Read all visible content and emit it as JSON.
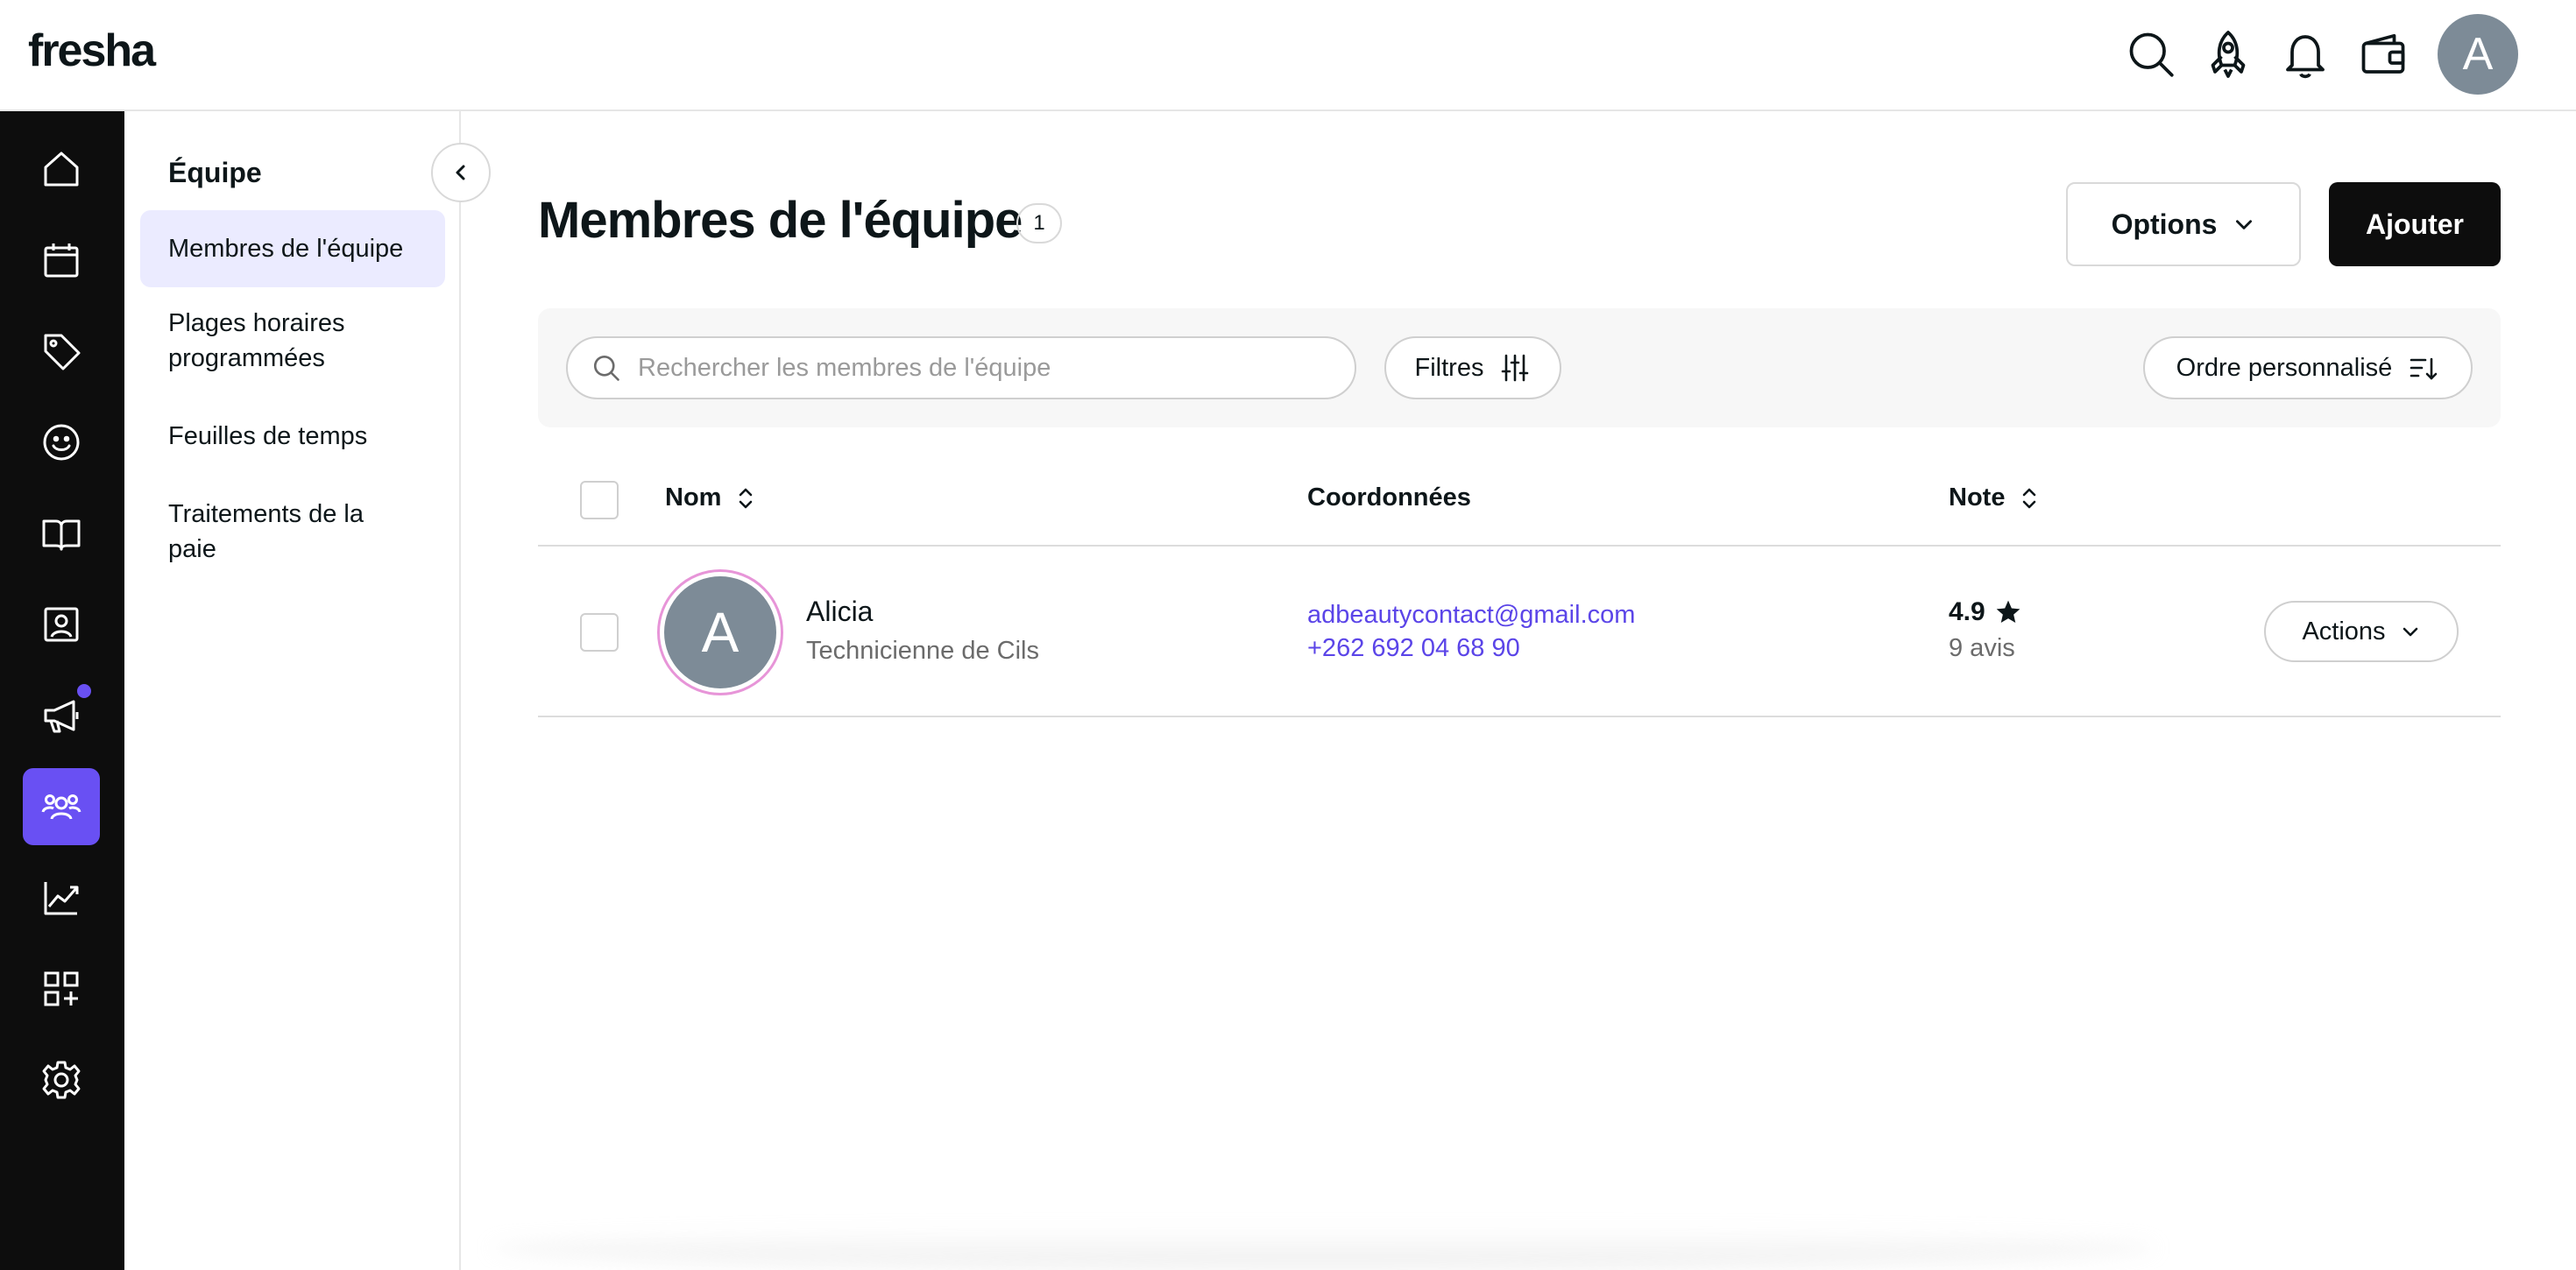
{
  "app": {
    "logo": "fresha",
    "avatar_initial": "A"
  },
  "topbar_icons": [
    "search-icon",
    "rocket-icon",
    "bell-icon",
    "wallet-icon"
  ],
  "rail": {
    "items": [
      {
        "name": "home",
        "icon": "home-icon"
      },
      {
        "name": "calendar",
        "icon": "calendar-icon"
      },
      {
        "name": "sales",
        "icon": "tag-icon"
      },
      {
        "name": "clients",
        "icon": "smiley-icon"
      },
      {
        "name": "catalog",
        "icon": "book-icon"
      },
      {
        "name": "online-profile",
        "icon": "profile-card-icon"
      },
      {
        "name": "marketing",
        "icon": "megaphone-icon",
        "badge": true
      },
      {
        "name": "team",
        "icon": "team-icon",
        "active": true
      },
      {
        "name": "reports",
        "icon": "chart-icon"
      },
      {
        "name": "add-ons",
        "icon": "apps-add-icon"
      },
      {
        "name": "settings",
        "icon": "gear-icon"
      }
    ],
    "accent": "#6950f3"
  },
  "subnav": {
    "title": "Équipe",
    "items": [
      {
        "label": "Membres de l'équipe",
        "active": true
      },
      {
        "label": "Plages horaires programmées"
      },
      {
        "label": "Feuilles de temps"
      },
      {
        "label": "Traitements de la paie"
      }
    ]
  },
  "main": {
    "title": "Membres de l'équipe",
    "count": "1",
    "options_label": "Options",
    "add_label": "Ajouter"
  },
  "toolbar": {
    "search_placeholder": "Rechercher les membres de l'équipe",
    "filters_label": "Filtres",
    "sort_label": "Ordre personnalisé"
  },
  "table": {
    "columns": {
      "name": "Nom",
      "contact": "Coordonnées",
      "rating": "Note"
    },
    "rows": [
      {
        "initial": "A",
        "name": "Alicia",
        "role": "Technicienne de Cils",
        "email": "adbeautycontact@gmail.com",
        "phone": "+262 692 04 68 90",
        "rating": "4.9",
        "reviews": "9 avis",
        "actions_label": "Actions"
      }
    ]
  },
  "colors": {
    "link": "#5b45e8",
    "avatar_ring": "#e795d8",
    "avatar_bg": "#7d8b97"
  }
}
